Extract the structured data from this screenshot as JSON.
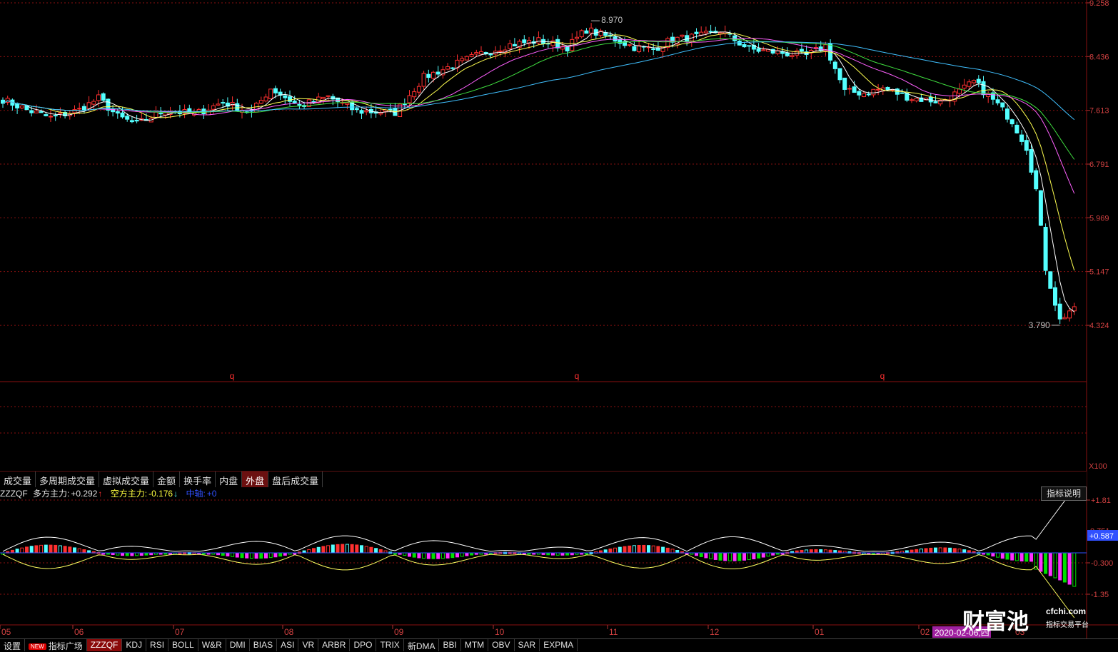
{
  "chart_data": [
    {
      "type": "candlestick",
      "y_ticks": [
        "9.258",
        "8.436",
        "7.613",
        "6.791",
        "5.969",
        "5.147",
        "4.324"
      ],
      "ylim": [
        3.79,
        9.258
      ],
      "high_label": "8.970",
      "low_label": "3.790",
      "markers": [
        "q",
        "q",
        "q"
      ],
      "x_labels": [
        "05",
        "06",
        "07",
        "08",
        "09",
        "10",
        "11",
        "12",
        "01",
        "02",
        "03"
      ],
      "cursor_date": "2020-02-06,四",
      "series": [
        {
          "name": "MA5",
          "color": "#ffffff"
        },
        {
          "name": "MA10",
          "color": "#ffff50"
        },
        {
          "name": "MA20",
          "color": "#ff60ff"
        },
        {
          "name": "MA30",
          "color": "#40e040"
        },
        {
          "name": "MA60",
          "color": "#40c0ff"
        }
      ],
      "anchors": [
        [
          0,
          7.78
        ],
        [
          5,
          7.62
        ],
        [
          10,
          7.5
        ],
        [
          16,
          7.62
        ],
        [
          20,
          7.8
        ],
        [
          24,
          7.52
        ],
        [
          28,
          7.4
        ],
        [
          34,
          7.62
        ],
        [
          40,
          7.55
        ],
        [
          46,
          7.74
        ],
        [
          52,
          7.58
        ],
        [
          56,
          7.95
        ],
        [
          62,
          7.68
        ],
        [
          68,
          7.82
        ],
        [
          74,
          7.6
        ],
        [
          82,
          7.58
        ],
        [
          88,
          8.12
        ],
        [
          94,
          8.3
        ],
        [
          100,
          8.48
        ],
        [
          106,
          8.62
        ],
        [
          112,
          8.68
        ],
        [
          118,
          8.58
        ],
        [
          122,
          8.85
        ],
        [
          128,
          8.7
        ],
        [
          132,
          8.58
        ],
        [
          136,
          8.55
        ],
        [
          140,
          8.7
        ],
        [
          146,
          8.75
        ],
        [
          150,
          8.83
        ],
        [
          156,
          8.55
        ],
        [
          162,
          8.5
        ],
        [
          168,
          8.45
        ],
        [
          172,
          8.6
        ],
        [
          176,
          7.9
        ],
        [
          180,
          7.88
        ],
        [
          184,
          7.95
        ],
        [
          190,
          7.8
        ],
        [
          196,
          7.75
        ],
        [
          200,
          7.9
        ],
        [
          203,
          8.05
        ],
        [
          208,
          7.7
        ],
        [
          211,
          7.45
        ],
        [
          214,
          7.05
        ],
        [
          216,
          6.4
        ],
        [
          218,
          5.2
        ],
        [
          221,
          4.4
        ],
        [
          223,
          4.55
        ]
      ]
    },
    {
      "type": "oscillator",
      "name": "ZZZQF",
      "y_ticks": [
        "+1.81",
        "-0.300",
        "-1.35"
      ],
      "cursor_value": "+0.587",
      "faded_tick": "0.751"
    }
  ],
  "main_axis": {
    "lower_label": "X100"
  },
  "tabs": [
    "成交量",
    "多周期成交量",
    "虚拟成交量",
    "金额",
    "换手率",
    "内盘",
    "外盘",
    "盘后成交量"
  ],
  "active_tab": "外盘",
  "indicator": {
    "name": "ZZZQF",
    "long_label": "多方主力:",
    "long_value": "+0.292",
    "long_arrow": "↑",
    "short_label": "空方主力:",
    "short_value": "-0.176",
    "short_arrow": "↓",
    "mid_label": "中轴:",
    "mid_value": "+0",
    "help_button": "指标说明"
  },
  "colors": {
    "up": "#ff3030",
    "down": "#54ffff",
    "grid": "#8a1010",
    "long": "#ff30ff",
    "short": "#00e000",
    "mid": "#3050ff"
  },
  "bottom_tabs": [
    "设置",
    "指标广场",
    "ZZZQF",
    "KDJ",
    "RSI",
    "BOLL",
    "W&R",
    "DMI",
    "BIAS",
    "ASI",
    "VR",
    "ARBR",
    "DPO",
    "TRIX",
    "新DMA",
    "BBI",
    "MTM",
    "OBV",
    "SAR",
    "EXPMA"
  ],
  "new_badge": "NEW",
  "active_bottom_tab": "ZZZQF",
  "watermark": {
    "brand": "财富池",
    "url": "cfchi.com",
    "sub": "指标交易平台"
  }
}
